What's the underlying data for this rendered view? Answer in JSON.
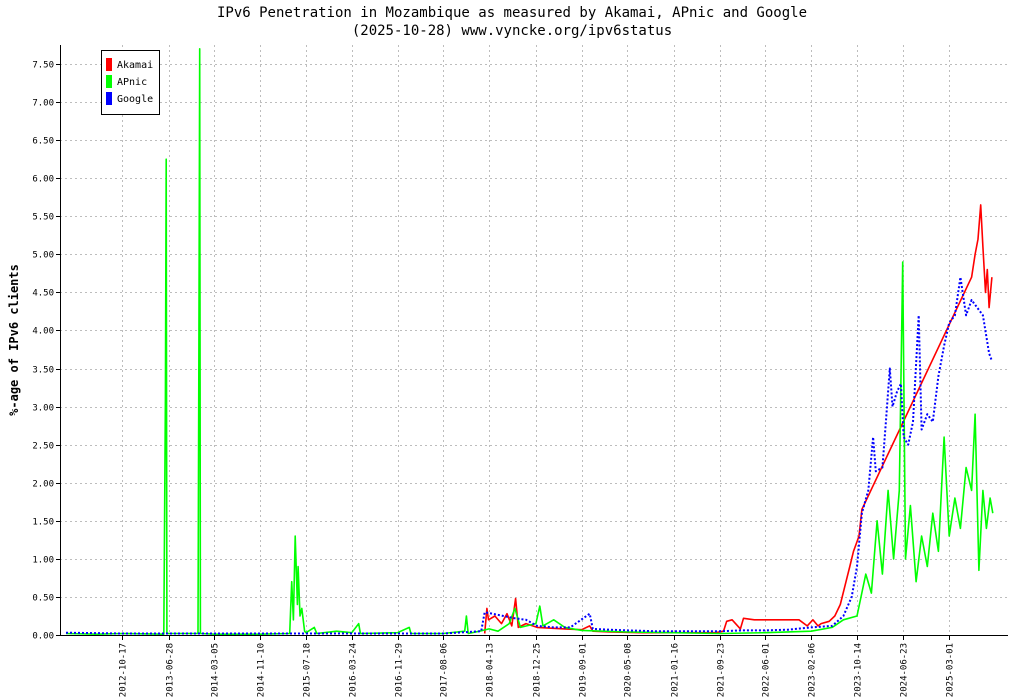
{
  "chart_data": {
    "type": "line",
    "title": "IPv6 Penetration in Mozambique as measured by Akamai, APnic and Google",
    "subtitle": "(2025-10-28) www.vyncke.org/ipv6status",
    "ylabel": "%-age of IPv6 clients",
    "xlabel": "",
    "ylim": [
      0,
      7.75
    ],
    "yticks": [
      "0.00",
      "0.50",
      "1.00",
      "1.50",
      "2.00",
      "2.50",
      "3.00",
      "3.50",
      "4.00",
      "4.50",
      "5.00",
      "5.50",
      "6.00",
      "6.50",
      "7.00",
      "7.50"
    ],
    "xlim": [
      "2011-11-12",
      "2026-01-16"
    ],
    "xticks": [
      "2012-10-17",
      "2013-06-28",
      "2014-03-05",
      "2014-11-10",
      "2015-07-18",
      "2016-03-24",
      "2016-11-29",
      "2017-08-06",
      "2018-04-13",
      "2018-12-25",
      "2019-09-01",
      "2020-05-08",
      "2021-01-16",
      "2021-09-23",
      "2022-06-01",
      "2023-02-06",
      "2023-10-14",
      "2024-06-23",
      "2025-03-01"
    ],
    "grid": true,
    "legend_position": "top-left",
    "series": [
      {
        "name": "Akamai",
        "color": "#ff0000",
        "points": [
          [
            "2018-03-20",
            0.02
          ],
          [
            "2018-04-01",
            0.35
          ],
          [
            "2018-04-10",
            0.2
          ],
          [
            "2018-05-15",
            0.25
          ],
          [
            "2018-06-20",
            0.15
          ],
          [
            "2018-07-20",
            0.28
          ],
          [
            "2018-08-15",
            0.12
          ],
          [
            "2018-09-05",
            0.48
          ],
          [
            "2018-09-20",
            0.1
          ],
          [
            "2018-11-01",
            0.15
          ],
          [
            "2019-01-01",
            0.1
          ],
          [
            "2019-06-01",
            0.08
          ],
          [
            "2019-09-01",
            0.07
          ],
          [
            "2019-10-15",
            0.12
          ],
          [
            "2019-11-01",
            0.05
          ],
          [
            "2020-02-01",
            0.04
          ],
          [
            "2020-08-01",
            0.03
          ],
          [
            "2021-03-01",
            0.03
          ],
          [
            "2021-09-01",
            0.03
          ],
          [
            "2021-10-15",
            0.05
          ],
          [
            "2021-11-01",
            0.18
          ],
          [
            "2021-12-01",
            0.2
          ],
          [
            "2022-01-15",
            0.08
          ],
          [
            "2022-02-01",
            0.22
          ],
          [
            "2022-04-01",
            0.2
          ],
          [
            "2022-06-01",
            0.2
          ],
          [
            "2022-08-01",
            0.2
          ],
          [
            "2022-10-01",
            0.2
          ],
          [
            "2022-12-01",
            0.2
          ],
          [
            "2023-01-15",
            0.12
          ],
          [
            "2023-02-15",
            0.2
          ],
          [
            "2023-03-15",
            0.12
          ],
          [
            "2023-04-01",
            0.15
          ],
          [
            "2023-05-15",
            0.18
          ],
          [
            "2023-06-15",
            0.25
          ],
          [
            "2023-07-15",
            0.4
          ],
          [
            "2023-08-15",
            0.7
          ],
          [
            "2023-09-05",
            0.9
          ],
          [
            "2023-09-25",
            1.1
          ],
          [
            "2023-10-10",
            1.2
          ],
          [
            "2023-10-25",
            1.3
          ],
          [
            "2023-11-10",
            1.65
          ],
          [
            "2025-07-01",
            4.7
          ],
          [
            "2025-07-20",
            5.0
          ],
          [
            "2025-08-05",
            5.2
          ],
          [
            "2025-08-20",
            5.65
          ],
          [
            "2025-09-01",
            5.1
          ],
          [
            "2025-09-15",
            4.5
          ],
          [
            "2025-09-25",
            4.8
          ],
          [
            "2025-10-05",
            4.3
          ],
          [
            "2025-10-20",
            4.7
          ]
        ]
      },
      {
        "name": "APnic",
        "color": "#00ff00",
        "points": [
          [
            "2011-12-15",
            0.02
          ],
          [
            "2012-06-01",
            0.01
          ],
          [
            "2012-10-17",
            0.02
          ],
          [
            "2013-06-01",
            0.01
          ],
          [
            "2013-06-10",
            3.1
          ],
          [
            "2013-06-14",
            6.25
          ],
          [
            "2013-06-18",
            0.02
          ],
          [
            "2013-12-05",
            0.02
          ],
          [
            "2013-12-10",
            3.8
          ],
          [
            "2013-12-14",
            7.7
          ],
          [
            "2013-12-18",
            0.02
          ],
          [
            "2014-03-05",
            0.01
          ],
          [
            "2014-11-10",
            0.01
          ],
          [
            "2015-04-20",
            0.02
          ],
          [
            "2015-05-01",
            0.7
          ],
          [
            "2015-05-10",
            0.2
          ],
          [
            "2015-05-20",
            1.3
          ],
          [
            "2015-06-01",
            0.4
          ],
          [
            "2015-06-05",
            0.9
          ],
          [
            "2015-06-15",
            0.25
          ],
          [
            "2015-06-25",
            0.35
          ],
          [
            "2015-07-10",
            0.05
          ],
          [
            "2015-07-18",
            0.03
          ],
          [
            "2015-09-01",
            0.1
          ],
          [
            "2015-09-15",
            0.02
          ],
          [
            "2016-01-01",
            0.05
          ],
          [
            "2016-03-24",
            0.03
          ],
          [
            "2016-05-01",
            0.15
          ],
          [
            "2016-05-10",
            0.02
          ],
          [
            "2016-11-29",
            0.03
          ],
          [
            "2017-02-01",
            0.1
          ],
          [
            "2017-02-10",
            0.02
          ],
          [
            "2017-08-06",
            0.02
          ],
          [
            "2017-12-01",
            0.05
          ],
          [
            "2017-12-10",
            0.25
          ],
          [
            "2017-12-20",
            0.02
          ],
          [
            "2018-02-20",
            0.05
          ],
          [
            "2018-04-13",
            0.08
          ],
          [
            "2018-06-01",
            0.05
          ],
          [
            "2018-08-01",
            0.15
          ],
          [
            "2018-09-01",
            0.35
          ],
          [
            "2018-10-01",
            0.1
          ],
          [
            "2018-12-25",
            0.15
          ],
          [
            "2019-01-15",
            0.38
          ],
          [
            "2019-02-01",
            0.12
          ],
          [
            "2019-04-01",
            0.2
          ],
          [
            "2019-06-01",
            0.1
          ],
          [
            "2019-09-01",
            0.06
          ],
          [
            "2020-05-08",
            0.04
          ],
          [
            "2021-01-16",
            0.03
          ],
          [
            "2021-09-23",
            0.02
          ],
          [
            "2022-06-01",
            0.03
          ],
          [
            "2023-02-06",
            0.05
          ],
          [
            "2023-06-01",
            0.1
          ],
          [
            "2023-08-01",
            0.2
          ],
          [
            "2023-10-14",
            0.25
          ],
          [
            "2023-12-01",
            0.8
          ],
          [
            "2024-01-01",
            0.55
          ],
          [
            "2024-02-01",
            1.5
          ],
          [
            "2024-03-01",
            0.8
          ],
          [
            "2024-04-01",
            1.9
          ],
          [
            "2024-05-01",
            1.0
          ],
          [
            "2024-06-01",
            1.9
          ],
          [
            "2024-06-20",
            4.9
          ],
          [
            "2024-07-05",
            1.0
          ],
          [
            "2024-08-01",
            1.7
          ],
          [
            "2024-09-01",
            0.7
          ],
          [
            "2024-10-01",
            1.3
          ],
          [
            "2024-11-01",
            0.9
          ],
          [
            "2024-12-01",
            1.6
          ],
          [
            "2025-01-01",
            1.1
          ],
          [
            "2025-02-01",
            2.6
          ],
          [
            "2025-03-01",
            1.3
          ],
          [
            "2025-04-01",
            1.8
          ],
          [
            "2025-05-01",
            1.4
          ],
          [
            "2025-06-01",
            2.2
          ],
          [
            "2025-07-01",
            1.9
          ],
          [
            "2025-07-20",
            2.9
          ],
          [
            "2025-08-10",
            0.85
          ],
          [
            "2025-09-01",
            1.9
          ],
          [
            "2025-09-20",
            1.4
          ],
          [
            "2025-10-10",
            1.8
          ],
          [
            "2025-10-25",
            1.6
          ]
        ]
      },
      {
        "name": "Google",
        "color": "#0000ff",
        "points": [
          [
            "2011-12-15",
            0.03
          ],
          [
            "2012-10-17",
            0.02
          ],
          [
            "2013-06-28",
            0.02
          ],
          [
            "2014-03-05",
            0.02
          ],
          [
            "2014-11-10",
            0.02
          ],
          [
            "2015-07-18",
            0.02
          ],
          [
            "2016-03-24",
            0.02
          ],
          [
            "2016-11-29",
            0.02
          ],
          [
            "2017-08-06",
            0.02
          ],
          [
            "2018-03-01",
            0.05
          ],
          [
            "2018-03-20",
            0.3
          ],
          [
            "2018-05-01",
            0.28
          ],
          [
            "2018-07-01",
            0.25
          ],
          [
            "2018-09-01",
            0.22
          ],
          [
            "2018-11-01",
            0.2
          ],
          [
            "2019-01-01",
            0.12
          ],
          [
            "2019-04-01",
            0.1
          ],
          [
            "2019-07-01",
            0.1
          ],
          [
            "2019-10-15",
            0.28
          ],
          [
            "2019-11-01",
            0.08
          ],
          [
            "2020-02-01",
            0.07
          ],
          [
            "2020-05-08",
            0.06
          ],
          [
            "2020-10-01",
            0.05
          ],
          [
            "2021-01-16",
            0.05
          ],
          [
            "2021-09-23",
            0.05
          ],
          [
            "2022-02-01",
            0.06
          ],
          [
            "2022-06-01",
            0.06
          ],
          [
            "2022-10-01",
            0.07
          ],
          [
            "2023-02-06",
            0.1
          ],
          [
            "2023-06-01",
            0.12
          ],
          [
            "2023-08-01",
            0.25
          ],
          [
            "2023-09-15",
            0.5
          ],
          [
            "2023-10-14",
            0.9
          ],
          [
            "2023-11-10",
            1.6
          ],
          [
            "2023-12-15",
            1.9
          ],
          [
            "2024-01-10",
            2.6
          ],
          [
            "2024-01-25",
            2.15
          ],
          [
            "2024-03-01",
            2.2
          ],
          [
            "2024-03-20",
            2.8
          ],
          [
            "2024-04-10",
            3.5
          ],
          [
            "2024-04-25",
            3.0
          ],
          [
            "2024-05-20",
            3.2
          ],
          [
            "2024-06-10",
            3.3
          ],
          [
            "2024-06-25",
            2.6
          ],
          [
            "2024-07-20",
            2.5
          ],
          [
            "2024-08-15",
            2.8
          ],
          [
            "2024-09-15",
            4.2
          ],
          [
            "2024-10-01",
            2.7
          ],
          [
            "2024-11-01",
            2.9
          ],
          [
            "2024-12-01",
            2.8
          ],
          [
            "2025-01-01",
            3.4
          ],
          [
            "2025-02-01",
            3.8
          ],
          [
            "2025-03-01",
            4.1
          ],
          [
            "2025-04-01",
            4.2
          ],
          [
            "2025-05-01",
            4.7
          ],
          [
            "2025-06-01",
            4.2
          ],
          [
            "2025-07-01",
            4.4
          ],
          [
            "2025-08-01",
            4.3
          ],
          [
            "2025-09-01",
            4.2
          ],
          [
            "2025-10-05",
            3.7
          ],
          [
            "2025-10-20",
            3.6
          ]
        ]
      }
    ]
  }
}
